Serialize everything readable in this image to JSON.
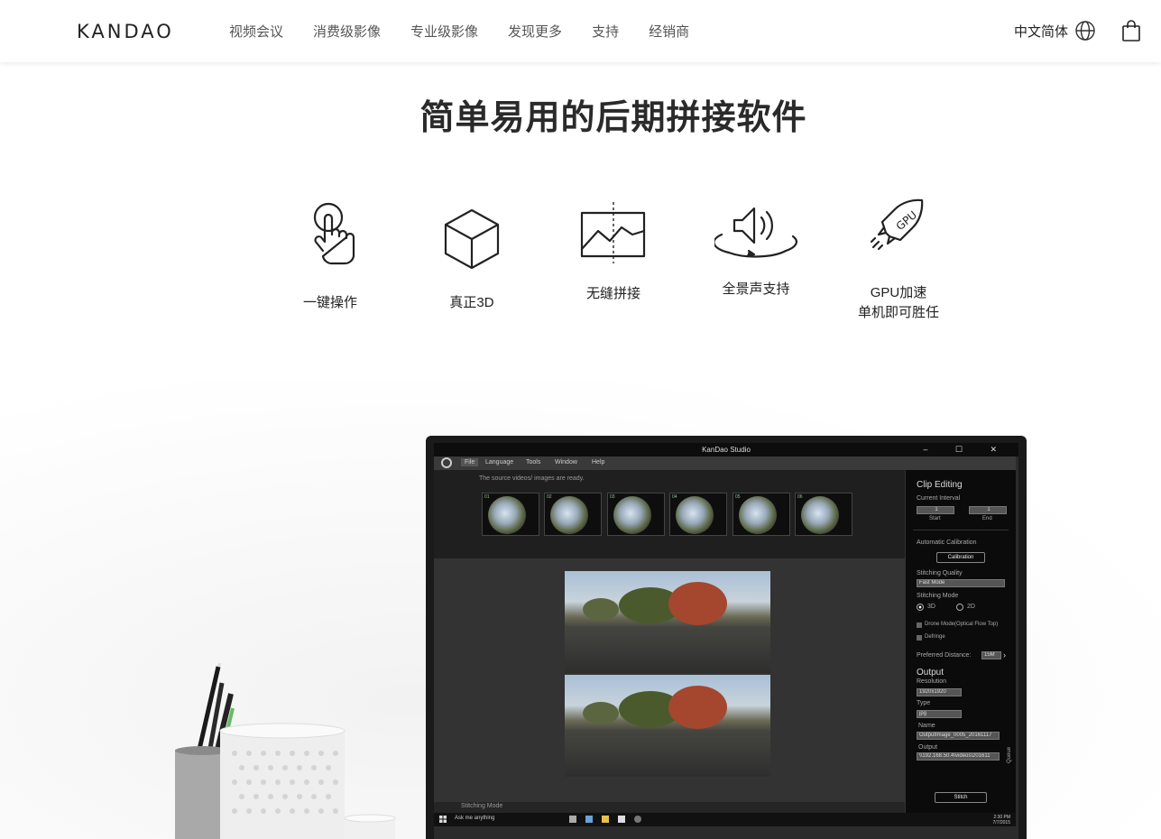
{
  "header": {
    "logo": "KANDAO",
    "nav": [
      "视频会议",
      "消费级影像",
      "专业级影像",
      "发现更多",
      "支持",
      "经销商"
    ],
    "language": "中文简体",
    "icons": [
      "globe-icon",
      "shopping-bag-icon"
    ]
  },
  "main": {
    "headline": "简单易用的后期拼接软件",
    "features": [
      {
        "icon": "touch-hand-icon",
        "label": "一键操作"
      },
      {
        "icon": "cube-icon",
        "label": "真正3D"
      },
      {
        "icon": "stitch-image-icon",
        "label": "无缝拼接"
      },
      {
        "icon": "panoramic-sound-icon",
        "label": "全景声支持"
      },
      {
        "icon": "gpu-rocket-icon",
        "label": "GPU加速",
        "label2": "单机即可胜任"
      }
    ]
  },
  "app": {
    "window_title": "KanDao Studio",
    "window_buttons": "– ☐ ✕",
    "menu": [
      "File",
      "Language",
      "Tools",
      "Window",
      "Help"
    ],
    "source_message": "The source videos/ images are ready.",
    "thumb_numbers": [
      "01",
      "02",
      "03",
      "04",
      "05",
      "06"
    ],
    "stitching_mode_label": "Stitching Mode",
    "taskbar": {
      "search": "Ask me anything",
      "time": "2:30 PM",
      "date": "7/7/2015"
    },
    "panel": {
      "clip_editing": "Clip Editing",
      "current_interval": "Current Interval",
      "start_value": "1",
      "end_value": "1",
      "start_label": "Start",
      "end_label": "End",
      "auto_calibration": "Automatic Calibration",
      "calibration_button": "Calibration",
      "stitching_quality": "Stitching Quality",
      "quality_value": "Fast Mode",
      "stitching_mode": "Stitching Mode",
      "mode_3d": "3D",
      "mode_2d": "2D",
      "drone_mode": "Drone Mode(Optical Flow Top)",
      "defringe": "Defringe",
      "preferred_distance": "Preferred Distance:",
      "distance_value": "15M",
      "output": "Output",
      "resolution": "Resolution",
      "resolution_value": "1920x1920",
      "type": "Type",
      "type_value": "jpg",
      "name": "Name",
      "name_value": "OutputImage_0005_20161117",
      "output_path_label": "Output",
      "output_path_value": "\\\\192.168.50.4\\videos\\201611",
      "stitch_button": "Stitch",
      "queue_tab": "Queue"
    }
  }
}
